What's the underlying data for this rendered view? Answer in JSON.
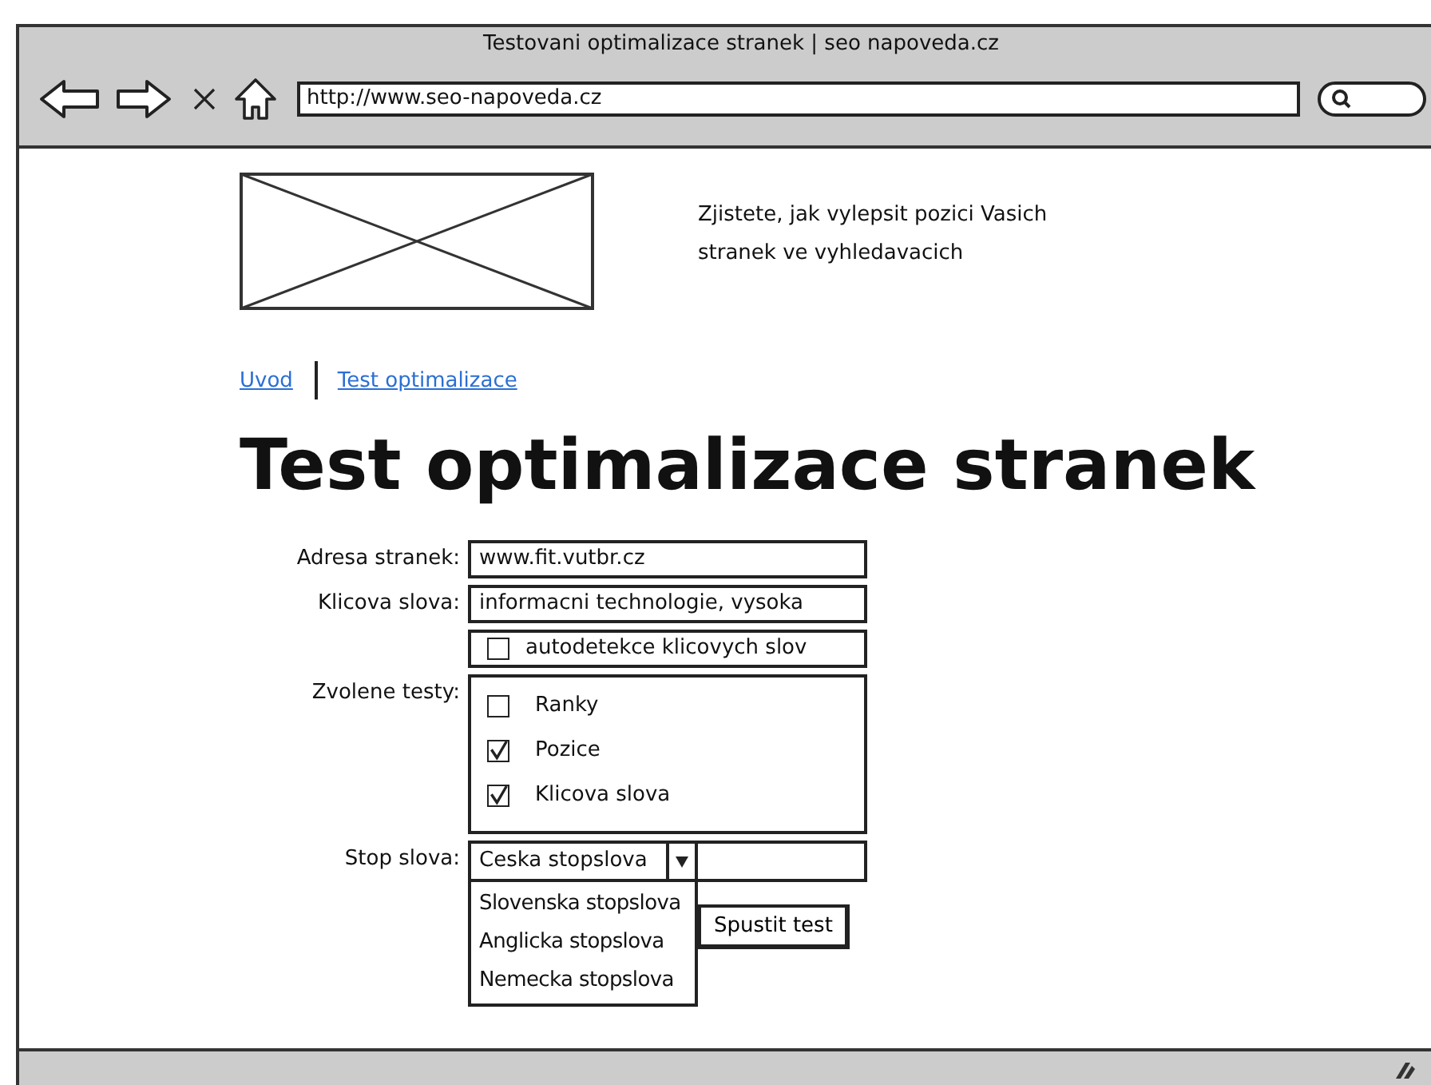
{
  "window": {
    "title": "Testovani optimalizace stranek | seo napoveda.cz"
  },
  "address_bar": {
    "value": "http://www.seo-napoveda.cz"
  },
  "header": {
    "tagline": "Zjistete, jak vylepsit pozici Vasich stranek ve vyhledavacich"
  },
  "breadcrumb": [
    {
      "label": "Uvod"
    },
    {
      "label": "Test optimalizace"
    }
  ],
  "heading": "Test optimalizace stranek",
  "form": {
    "address": {
      "label": "Adresa stranek:",
      "value": "www.fit.vutbr.cz"
    },
    "keywords": {
      "label": "Klicova slova:",
      "value": "informacni technologie, vysoka"
    },
    "autodetect": {
      "label": "autodetekce klicovych slov",
      "checked": false
    },
    "tests": {
      "label": "Zvolene testy:",
      "items": [
        {
          "label": "Ranky",
          "checked": false
        },
        {
          "label": "Pozice",
          "checked": true
        },
        {
          "label": "Klicova slova",
          "checked": true
        }
      ]
    },
    "stop_words": {
      "label": "Stop slova:",
      "value": "Ceska stopslova",
      "expanded": true,
      "options": [
        {
          "label": "Slovenska stopslova",
          "selected": false
        },
        {
          "label": "Anglicka stopslova",
          "selected": false
        },
        {
          "label": "Nemecka stopslova",
          "selected": false
        }
      ]
    },
    "submit": "Spustit test"
  }
}
